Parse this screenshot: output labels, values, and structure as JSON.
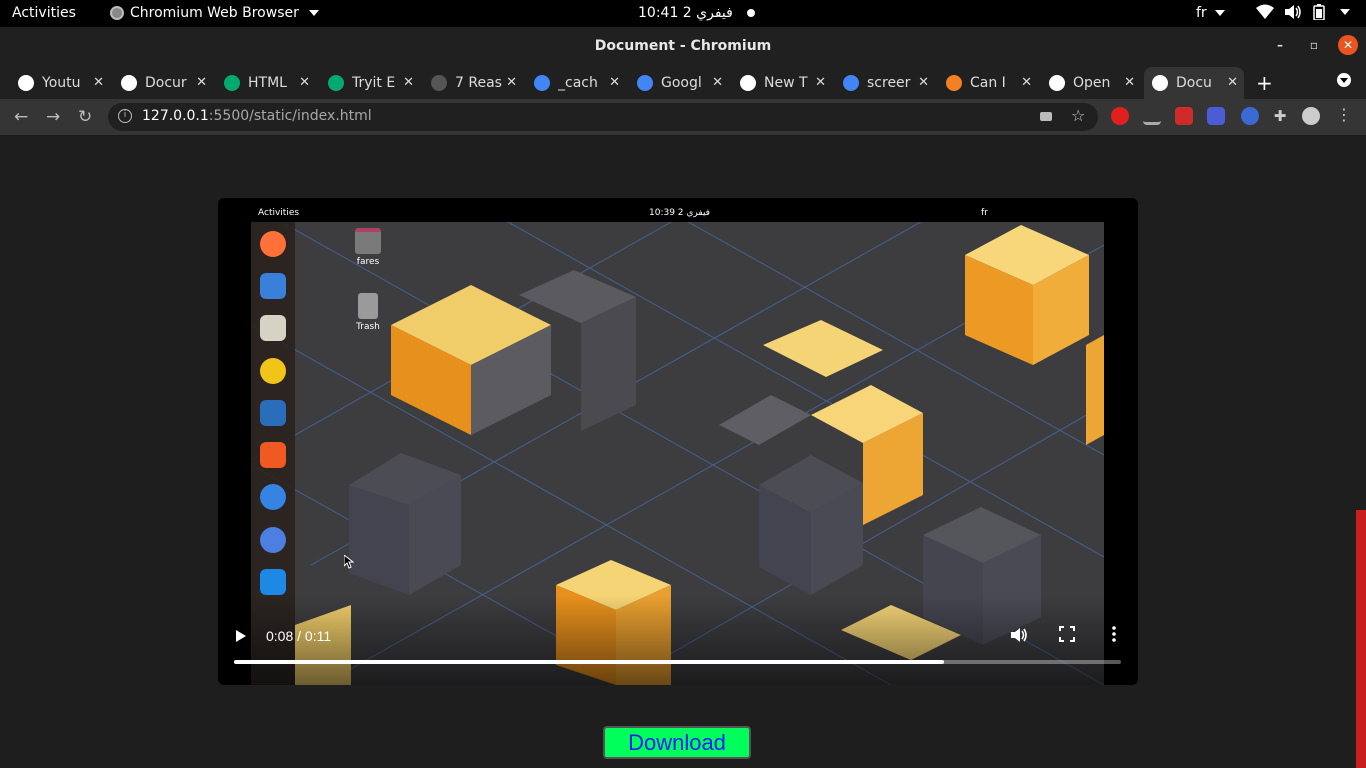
{
  "system_bar": {
    "activities": "Activities",
    "app_menu": "Chromium Web Browser",
    "clock": "10:41  2 فيفري",
    "language": "fr"
  },
  "window": {
    "title": "Document - Chromium"
  },
  "tabs": [
    {
      "label": "Youtu",
      "icon": "globe-icon",
      "color": "#ffffff"
    },
    {
      "label": "Docur",
      "icon": "globe-icon",
      "color": "#ffffff"
    },
    {
      "label": "HTML",
      "icon": "w3schools-icon",
      "color": "#04aa6d"
    },
    {
      "label": "Tryit E",
      "icon": "w3schools-icon",
      "color": "#04aa6d"
    },
    {
      "label": "7 Reas",
      "icon": "co-icon",
      "color": "#555555"
    },
    {
      "label": "_cach",
      "icon": "google-icon",
      "color": "#4285f4"
    },
    {
      "label": "Googl",
      "icon": "google-translate-icon",
      "color": "#4285f4"
    },
    {
      "label": "New T",
      "icon": "chromium-icon",
      "color": "#ffffff"
    },
    {
      "label": "screer",
      "icon": "google-icon",
      "color": "#4285f4"
    },
    {
      "label": "Can I",
      "icon": "stackoverflow-icon",
      "color": "#f48024"
    },
    {
      "label": "Open",
      "icon": "wikipedia-icon",
      "color": "#ffffff"
    },
    {
      "label": "Docu",
      "icon": "globe-icon",
      "color": "#ffffff"
    }
  ],
  "omnibox": {
    "host": "127.0.0.1",
    "path": ":5500/static/index.html"
  },
  "video": {
    "time": "0:08 / 0:11",
    "progress": 0.8,
    "inner": {
      "activities": "Activities",
      "clock": "10:39  2 فيفري",
      "language": "fr",
      "desktop_icons": [
        {
          "label": "fares",
          "icon": "home-folder-icon"
        },
        {
          "label": "Trash",
          "icon": "trash-icon"
        }
      ],
      "dock": [
        {
          "icon": "firefox-icon",
          "color": "#ff7139"
        },
        {
          "icon": "thunderbird-icon",
          "color": "#3a7fd9"
        },
        {
          "icon": "files-icon",
          "color": "#d6d2c4"
        },
        {
          "icon": "rhythmbox-icon",
          "color": "#f0c419"
        },
        {
          "icon": "libreoffice-writer-icon",
          "color": "#2a6ebb"
        },
        {
          "icon": "app-center-icon",
          "color": "#f05a22"
        },
        {
          "icon": "help-icon",
          "color": "#3584e4"
        },
        {
          "icon": "chromium-icon",
          "color": "#4c7fe0"
        },
        {
          "icon": "vscode-icon",
          "color": "#1e88e5"
        }
      ]
    }
  },
  "download_button": {
    "label": "Download"
  },
  "colors": {
    "download_bg": "#00ff5a",
    "download_text": "#1a1aff",
    "scroll_thumb": "#c81e1e"
  }
}
